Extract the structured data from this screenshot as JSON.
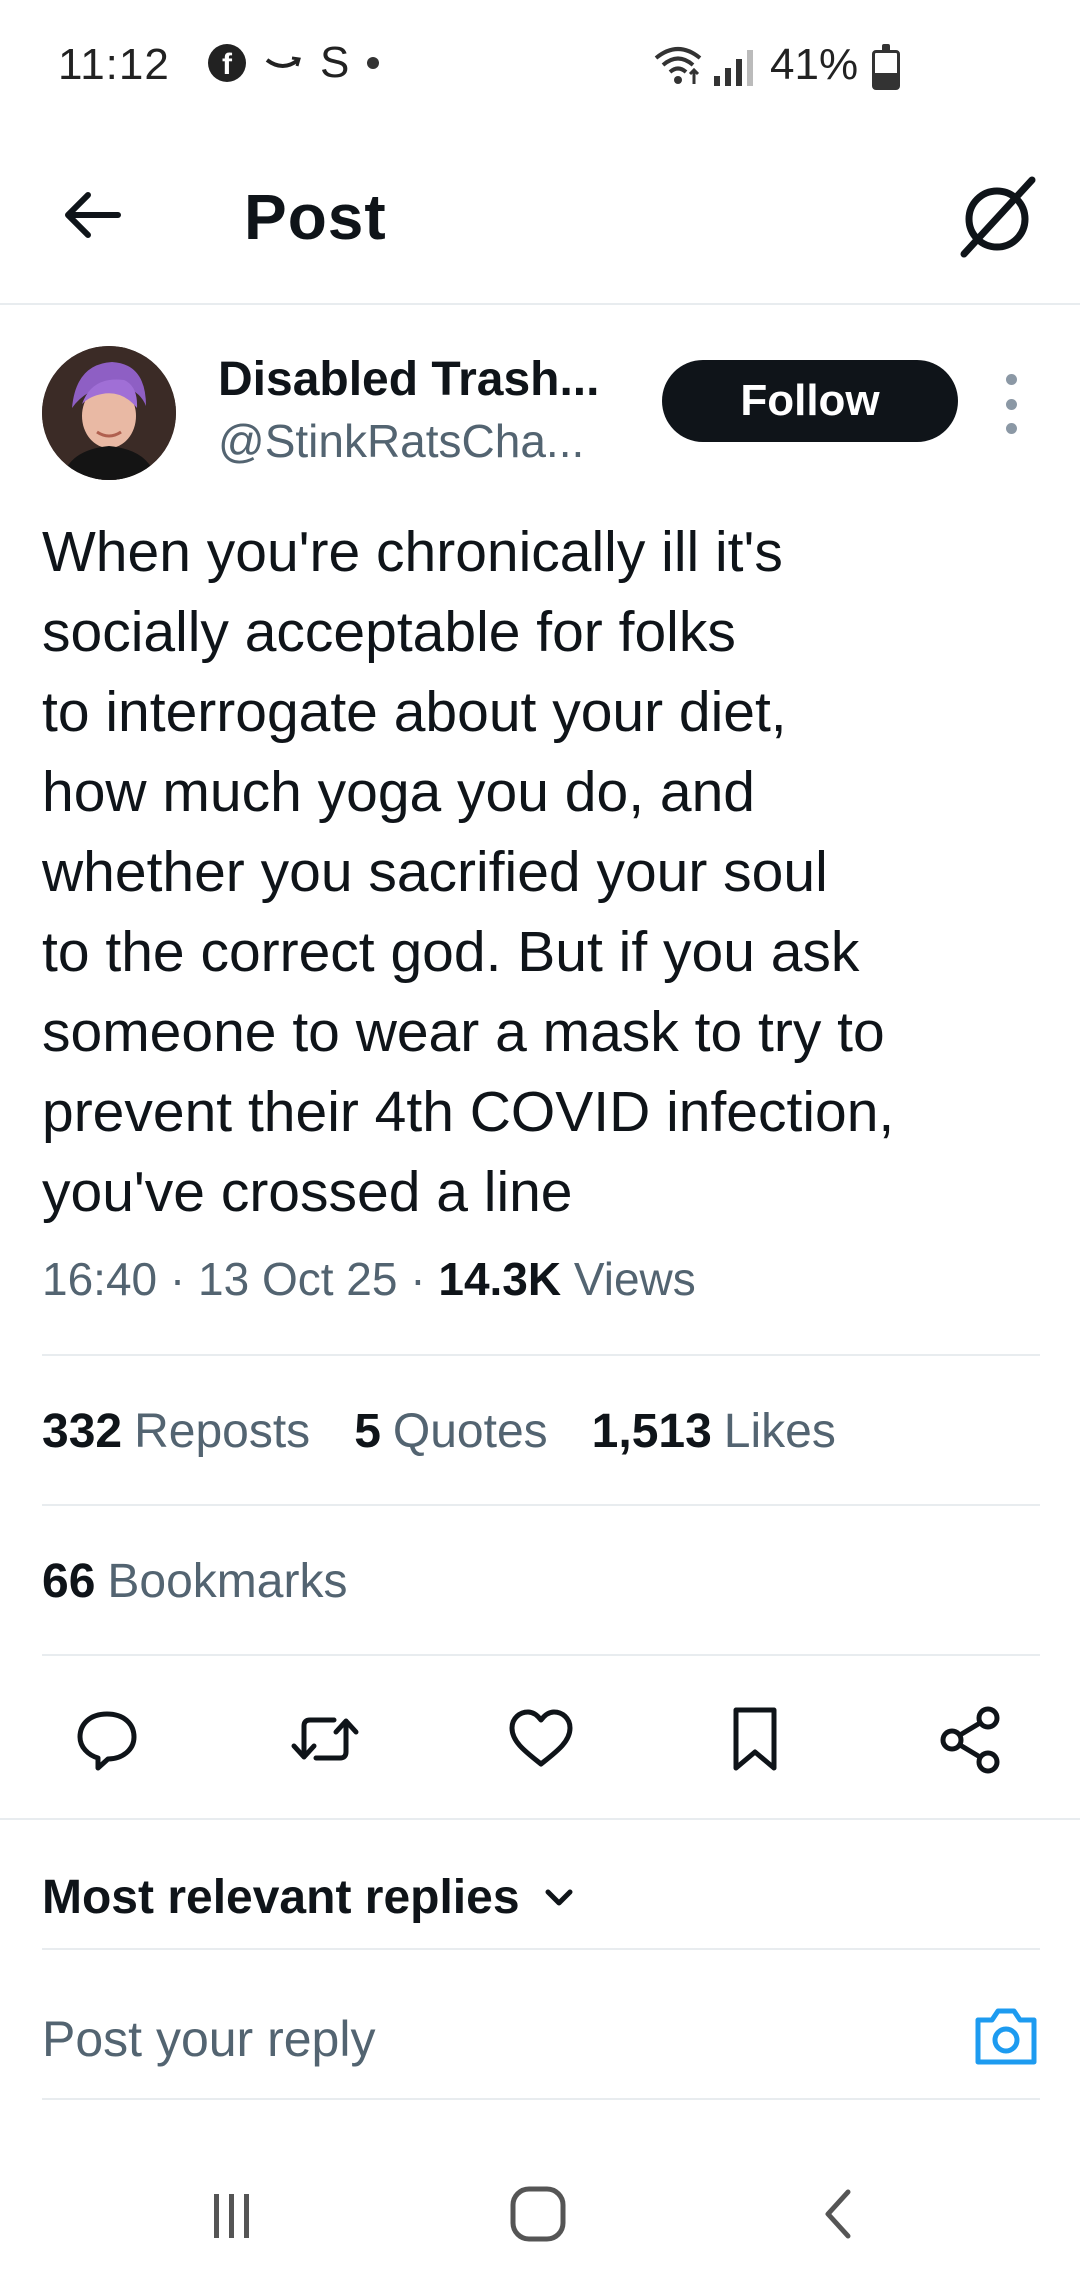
{
  "status_bar": {
    "time": "11:12",
    "notification_icons": [
      "facebook-icon",
      "amazon-icon",
      "skype-icon",
      "dot-icon"
    ],
    "system_icons": [
      "wifi-icon",
      "signal-icon"
    ],
    "battery_text": "41%",
    "battery_level": 0.41
  },
  "header": {
    "title": "Post",
    "back_icon": "arrow-left-icon",
    "grok_icon": "grok-icon"
  },
  "post": {
    "author": {
      "name": "Disabled Trash...",
      "handle": "@StinkRatsCha...",
      "avatar_icon": "avatar-photo"
    },
    "follow_label": "Follow",
    "text": "When you're chronically ill it's\nsocially acceptable for folks\nto interrogate about your diet,\nhow much yoga you do, and\nwhether you sacrified your soul\nto the correct god. But if you ask\nsomeone to wear a mask to try to\nprevent their 4th COVID infection,\nyou've crossed a line",
    "time": "16:40",
    "date": "13 Oct 25",
    "views_count": "14.3K",
    "views_label": "Views",
    "separator": "·"
  },
  "stats": {
    "reposts_count": "332",
    "reposts_label": "Reposts",
    "quotes_count": "5",
    "quotes_label": "Quotes",
    "likes_count": "1,513",
    "likes_label": "Likes",
    "bookmarks_count": "66",
    "bookmarks_label": "Bookmarks"
  },
  "actions": [
    "reply-icon",
    "repost-icon",
    "like-icon",
    "bookmark-icon",
    "share-icon"
  ],
  "replies": {
    "sort_label": "Most relevant replies",
    "reply_placeholder": "Post your reply"
  },
  "colors": {
    "text_primary": "#0f1419",
    "text_secondary": "#536471",
    "accent": "#1d9bf0",
    "divider": "#e8ecef"
  }
}
